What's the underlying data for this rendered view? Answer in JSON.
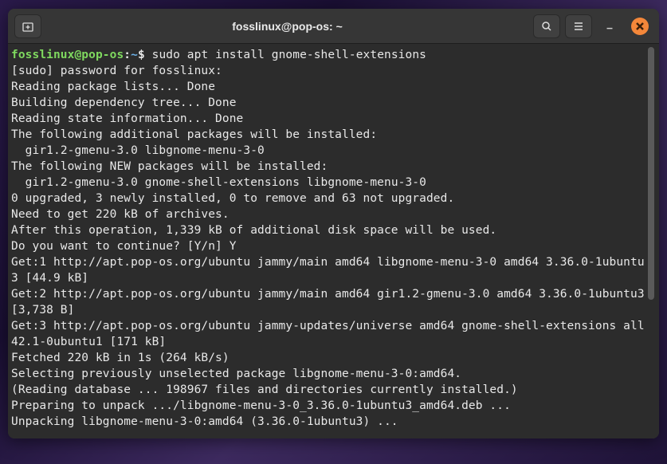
{
  "window": {
    "title": "fosslinux@pop-os: ~"
  },
  "prompt": {
    "user_host": "fosslinux@pop-os",
    "separator": ":",
    "path": "~",
    "dollar": "$ ",
    "command": "sudo apt install gnome-shell-extensions"
  },
  "output_lines": [
    "[sudo] password for fosslinux: ",
    "Reading package lists... Done",
    "Building dependency tree... Done",
    "Reading state information... Done",
    "The following additional packages will be installed:",
    "  gir1.2-gmenu-3.0 libgnome-menu-3-0",
    "The following NEW packages will be installed:",
    "  gir1.2-gmenu-3.0 gnome-shell-extensions libgnome-menu-3-0",
    "0 upgraded, 3 newly installed, 0 to remove and 63 not upgraded.",
    "Need to get 220 kB of archives.",
    "After this operation, 1,339 kB of additional disk space will be used.",
    "Do you want to continue? [Y/n] Y",
    "Get:1 http://apt.pop-os.org/ubuntu jammy/main amd64 libgnome-menu-3-0 amd64 3.36.0-1ubuntu3 [44.9 kB]",
    "Get:2 http://apt.pop-os.org/ubuntu jammy/main amd64 gir1.2-gmenu-3.0 amd64 3.36.0-1ubuntu3 [3,738 B]",
    "Get:3 http://apt.pop-os.org/ubuntu jammy-updates/universe amd64 gnome-shell-extensions all 42.1-0ubuntu1 [171 kB]",
    "Fetched 220 kB in 1s (264 kB/s)",
    "Selecting previously unselected package libgnome-menu-3-0:amd64.",
    "(Reading database ... 198967 files and directories currently installed.)",
    "Preparing to unpack .../libgnome-menu-3-0_3.36.0-1ubuntu3_amd64.deb ...",
    "Unpacking libgnome-menu-3-0:amd64 (3.36.0-1ubuntu3) ..."
  ],
  "icons": {
    "new_tab": "new-tab-icon",
    "search": "search-icon",
    "menu": "hamburger-icon",
    "minimize": "minimize-icon",
    "close": "close-icon"
  }
}
